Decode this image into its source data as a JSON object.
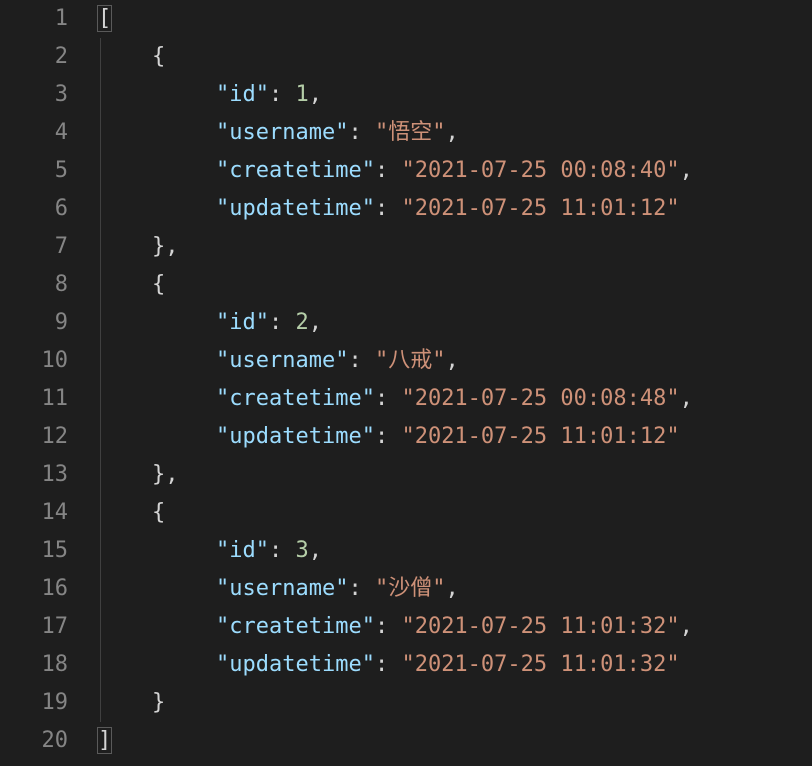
{
  "lineNumbers": [
    "1",
    "2",
    "3",
    "4",
    "5",
    "6",
    "7",
    "8",
    "9",
    "10",
    "11",
    "12",
    "13",
    "14",
    "15",
    "16",
    "17",
    "18",
    "19",
    "20"
  ],
  "brackets": {
    "open": "[",
    "close": "]",
    "objOpen": "{",
    "objClose": "}",
    "objCloseComma": "},",
    "comma": ","
  },
  "keys": {
    "id": "\"id\"",
    "username": "\"username\"",
    "createtime": "\"createtime\"",
    "updatetime": "\"updatetime\""
  },
  "colon": ": ",
  "records": [
    {
      "id": "1",
      "username": "\"悟空\"",
      "createtime": "\"2021-07-25 00:08:40\"",
      "updatetime": "\"2021-07-25 11:01:12\""
    },
    {
      "id": "2",
      "username": "\"八戒\"",
      "createtime": "\"2021-07-25 00:08:48\"",
      "updatetime": "\"2021-07-25 11:01:12\""
    },
    {
      "id": "3",
      "username": "\"沙僧\"",
      "createtime": "\"2021-07-25 11:01:32\"",
      "updatetime": "\"2021-07-25 11:01:32\""
    }
  ]
}
